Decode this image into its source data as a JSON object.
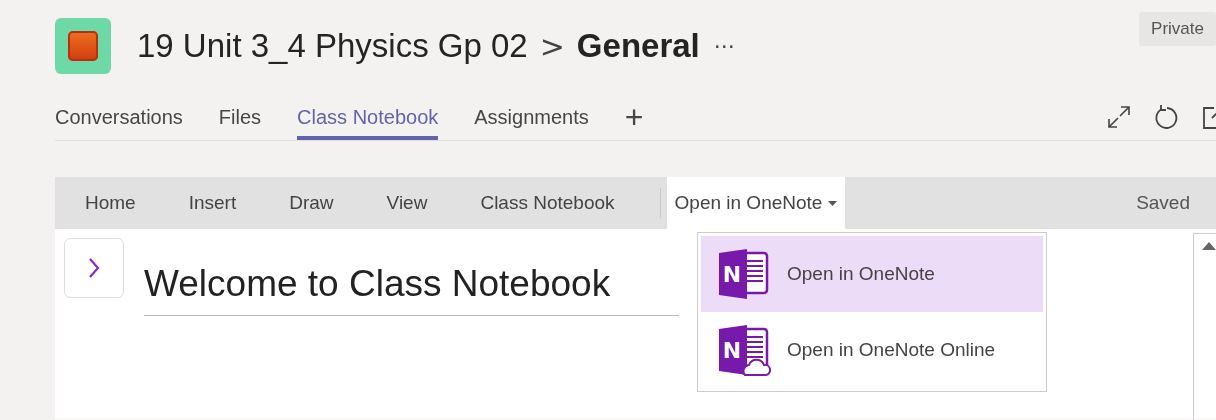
{
  "header": {
    "team": "19 Unit 3_4 Physics Gp 02",
    "separator": ">",
    "channel": "General",
    "more": "···",
    "badge": "Private"
  },
  "tabs": [
    {
      "label": "Conversations",
      "selected": false
    },
    {
      "label": "Files",
      "selected": false
    },
    {
      "label": "Class Notebook",
      "selected": true
    },
    {
      "label": "Assignments",
      "selected": false
    }
  ],
  "add_tab": "+",
  "ribbon": {
    "tabs": [
      "Home",
      "Insert",
      "Draw",
      "View",
      "Class Notebook"
    ],
    "open_menu": {
      "label": "Open in OneNote",
      "expanded": true
    },
    "status": "Saved"
  },
  "page": {
    "title": "Welcome to Class Notebook"
  },
  "menu": [
    {
      "label": "Open in OneNote",
      "kind": "desktop",
      "icon_letter": "N",
      "selected": true
    },
    {
      "label": "Open in OneNote Online",
      "kind": "online",
      "icon_letter": "N",
      "selected": false
    }
  ]
}
